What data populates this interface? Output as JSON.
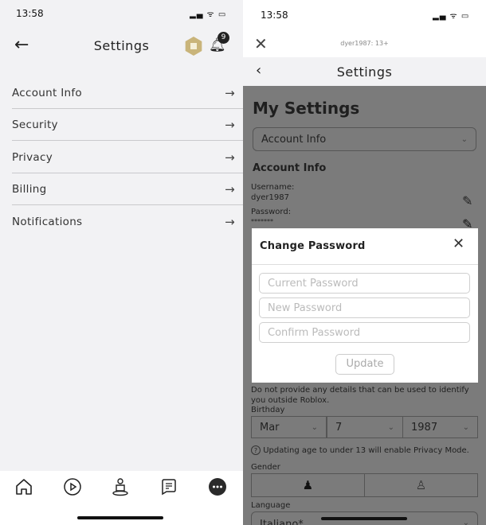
{
  "left": {
    "status_time": "13:58",
    "header": {
      "title": "Settings",
      "notification_count": "9",
      "robux_color": "#c9b47a"
    },
    "menu": [
      {
        "label": "Account Info"
      },
      {
        "label": "Security"
      },
      {
        "label": "Privacy"
      },
      {
        "label": "Billing"
      },
      {
        "label": "Notifications"
      }
    ],
    "nav": [
      "home-icon",
      "play-icon",
      "avatar-icon",
      "chat-icon",
      "more-icon"
    ]
  },
  "right": {
    "status_time": "13:58",
    "browser_title": "dyer1987: 13+",
    "header_title": "Settings",
    "page_title": "My Settings",
    "section_select": "Account Info",
    "section_heading": "Account Info",
    "username_label": "Username:",
    "username": "dyer1987",
    "password_label": "Password:",
    "password": "*******",
    "description_hint": "Do not provide any details that can be used to identify you outside Roblox.",
    "birthday_label": "Birthday",
    "birthday": {
      "month": "Mar",
      "day": "7",
      "year": "1987"
    },
    "age_note": "Updating age to under 13 will enable Privacy Mode.",
    "gender_label": "Gender",
    "language_label": "Language",
    "language": "Italiano*",
    "modal": {
      "title": "Change Password",
      "current_placeholder": "Current Password",
      "new_placeholder": "New Password",
      "confirm_placeholder": "Confirm Password",
      "update_label": "Update"
    }
  }
}
